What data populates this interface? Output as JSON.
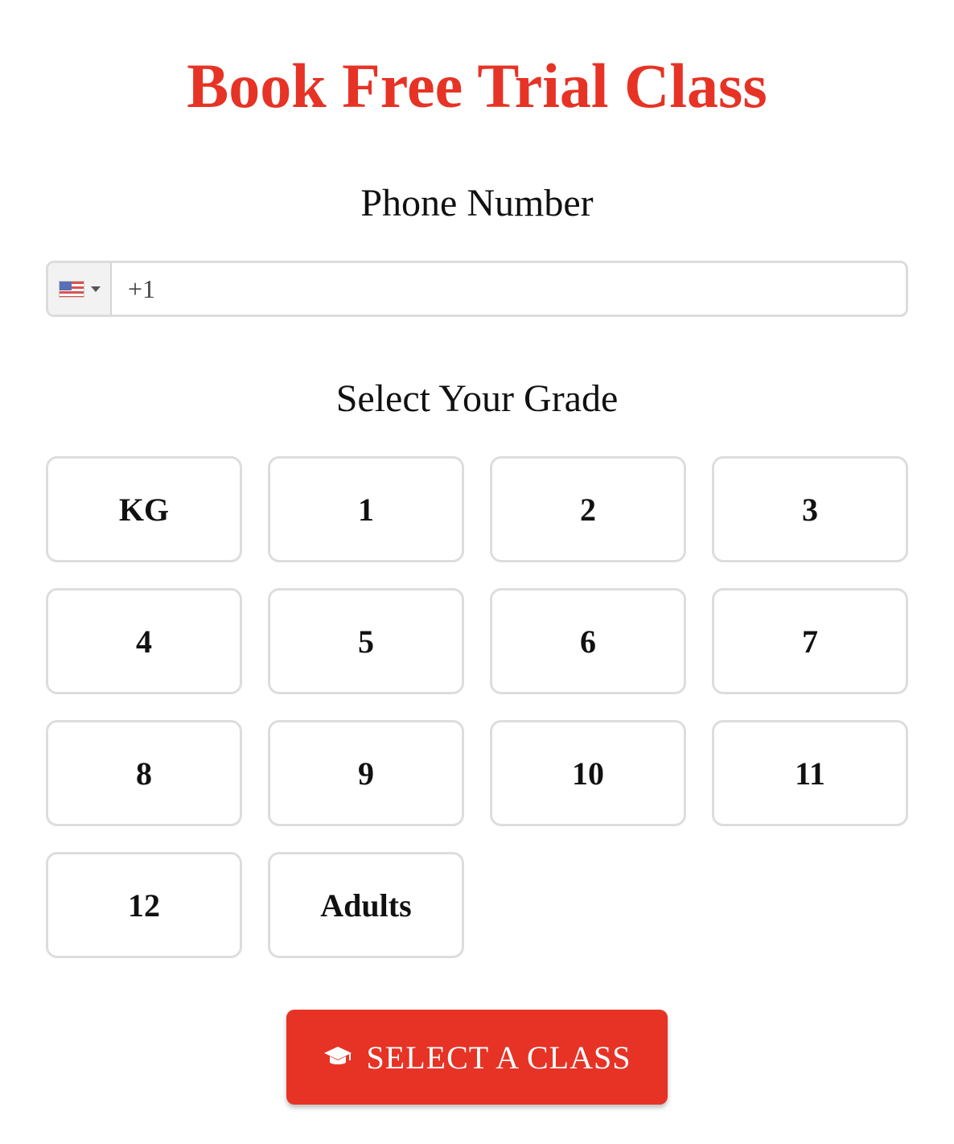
{
  "header": {
    "title": "Book Free Trial Class"
  },
  "phone": {
    "label": "Phone Number",
    "country_icon": "us-flag-icon",
    "value": "+1"
  },
  "grade": {
    "label": "Select Your Grade",
    "options": [
      "KG",
      "1",
      "2",
      "3",
      "4",
      "5",
      "6",
      "7",
      "8",
      "9",
      "10",
      "11",
      "12",
      "Adults"
    ]
  },
  "cta": {
    "icon": "graduation-cap-icon",
    "label": "SELECT A CLASS"
  },
  "colors": {
    "accent": "#e63325",
    "border": "#dddddd"
  }
}
